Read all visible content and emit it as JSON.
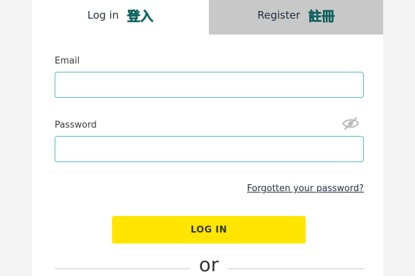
{
  "tabs": {
    "login_label": "Log in",
    "login_cjk": "登入",
    "register_label": "Register",
    "register_cjk": "註冊"
  },
  "form": {
    "email_label": "Email",
    "email_value": "",
    "password_label": "Password",
    "password_value": "",
    "forgot_link": "Forgotten your password?",
    "login_button": "LOG IN",
    "or_text": "or"
  },
  "icons": {
    "password_toggle": "eye-slash-icon"
  },
  "colors": {
    "accent_teal": "#4fb9c4",
    "button_yellow": "#ffe500",
    "inactive_tab": "#c8c8c8"
  }
}
